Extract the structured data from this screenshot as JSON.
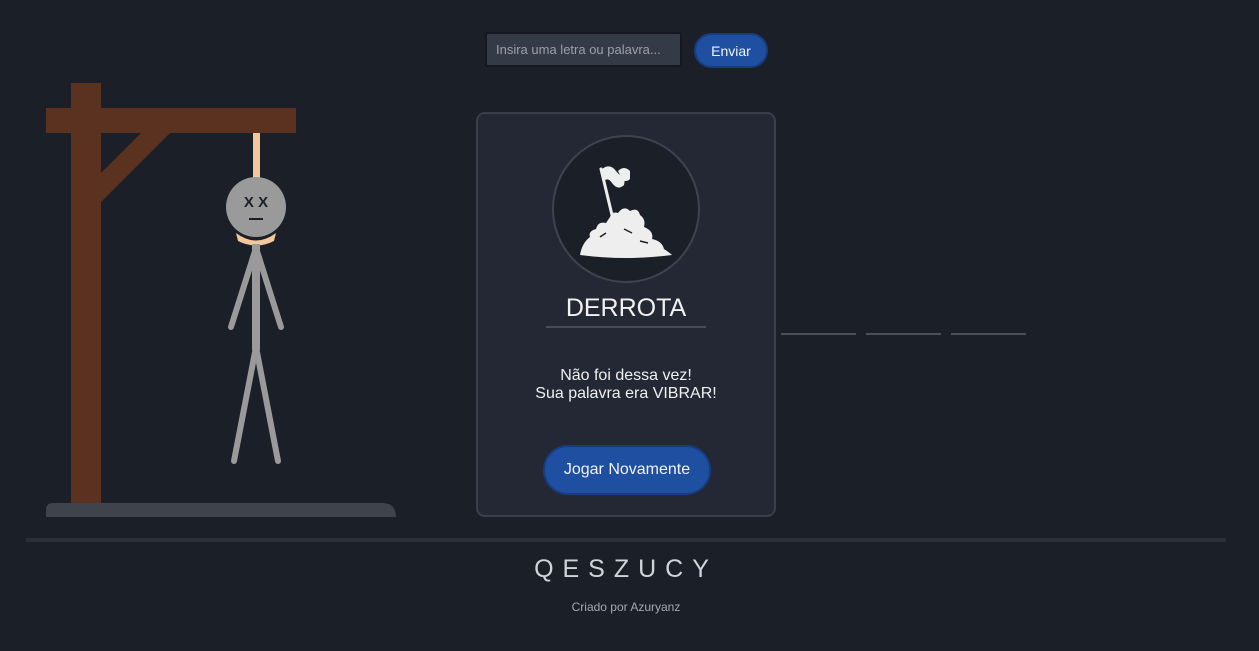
{
  "guess": {
    "placeholder": "Insira uma letra ou palavra...",
    "value": "",
    "send_label": "Enviar"
  },
  "hangman": {
    "face": "X X",
    "state": "dead"
  },
  "result": {
    "icon": "surrender-flag-icon",
    "title": "DERROTA",
    "message_line1": "Não foi dessa vez!",
    "message_line2": "Sua palavra era VIBRAR!",
    "replay_label": "Jogar Novamente"
  },
  "word_blanks_visible": 3,
  "footer": {
    "brand": "QESZUCY",
    "credit": "Criado por Azuryanz"
  },
  "colors": {
    "background": "#1b1f27",
    "card": "#232834",
    "accent": "#1f4fa0",
    "wood": "#5b3220",
    "figure": "#9a9a9a"
  }
}
